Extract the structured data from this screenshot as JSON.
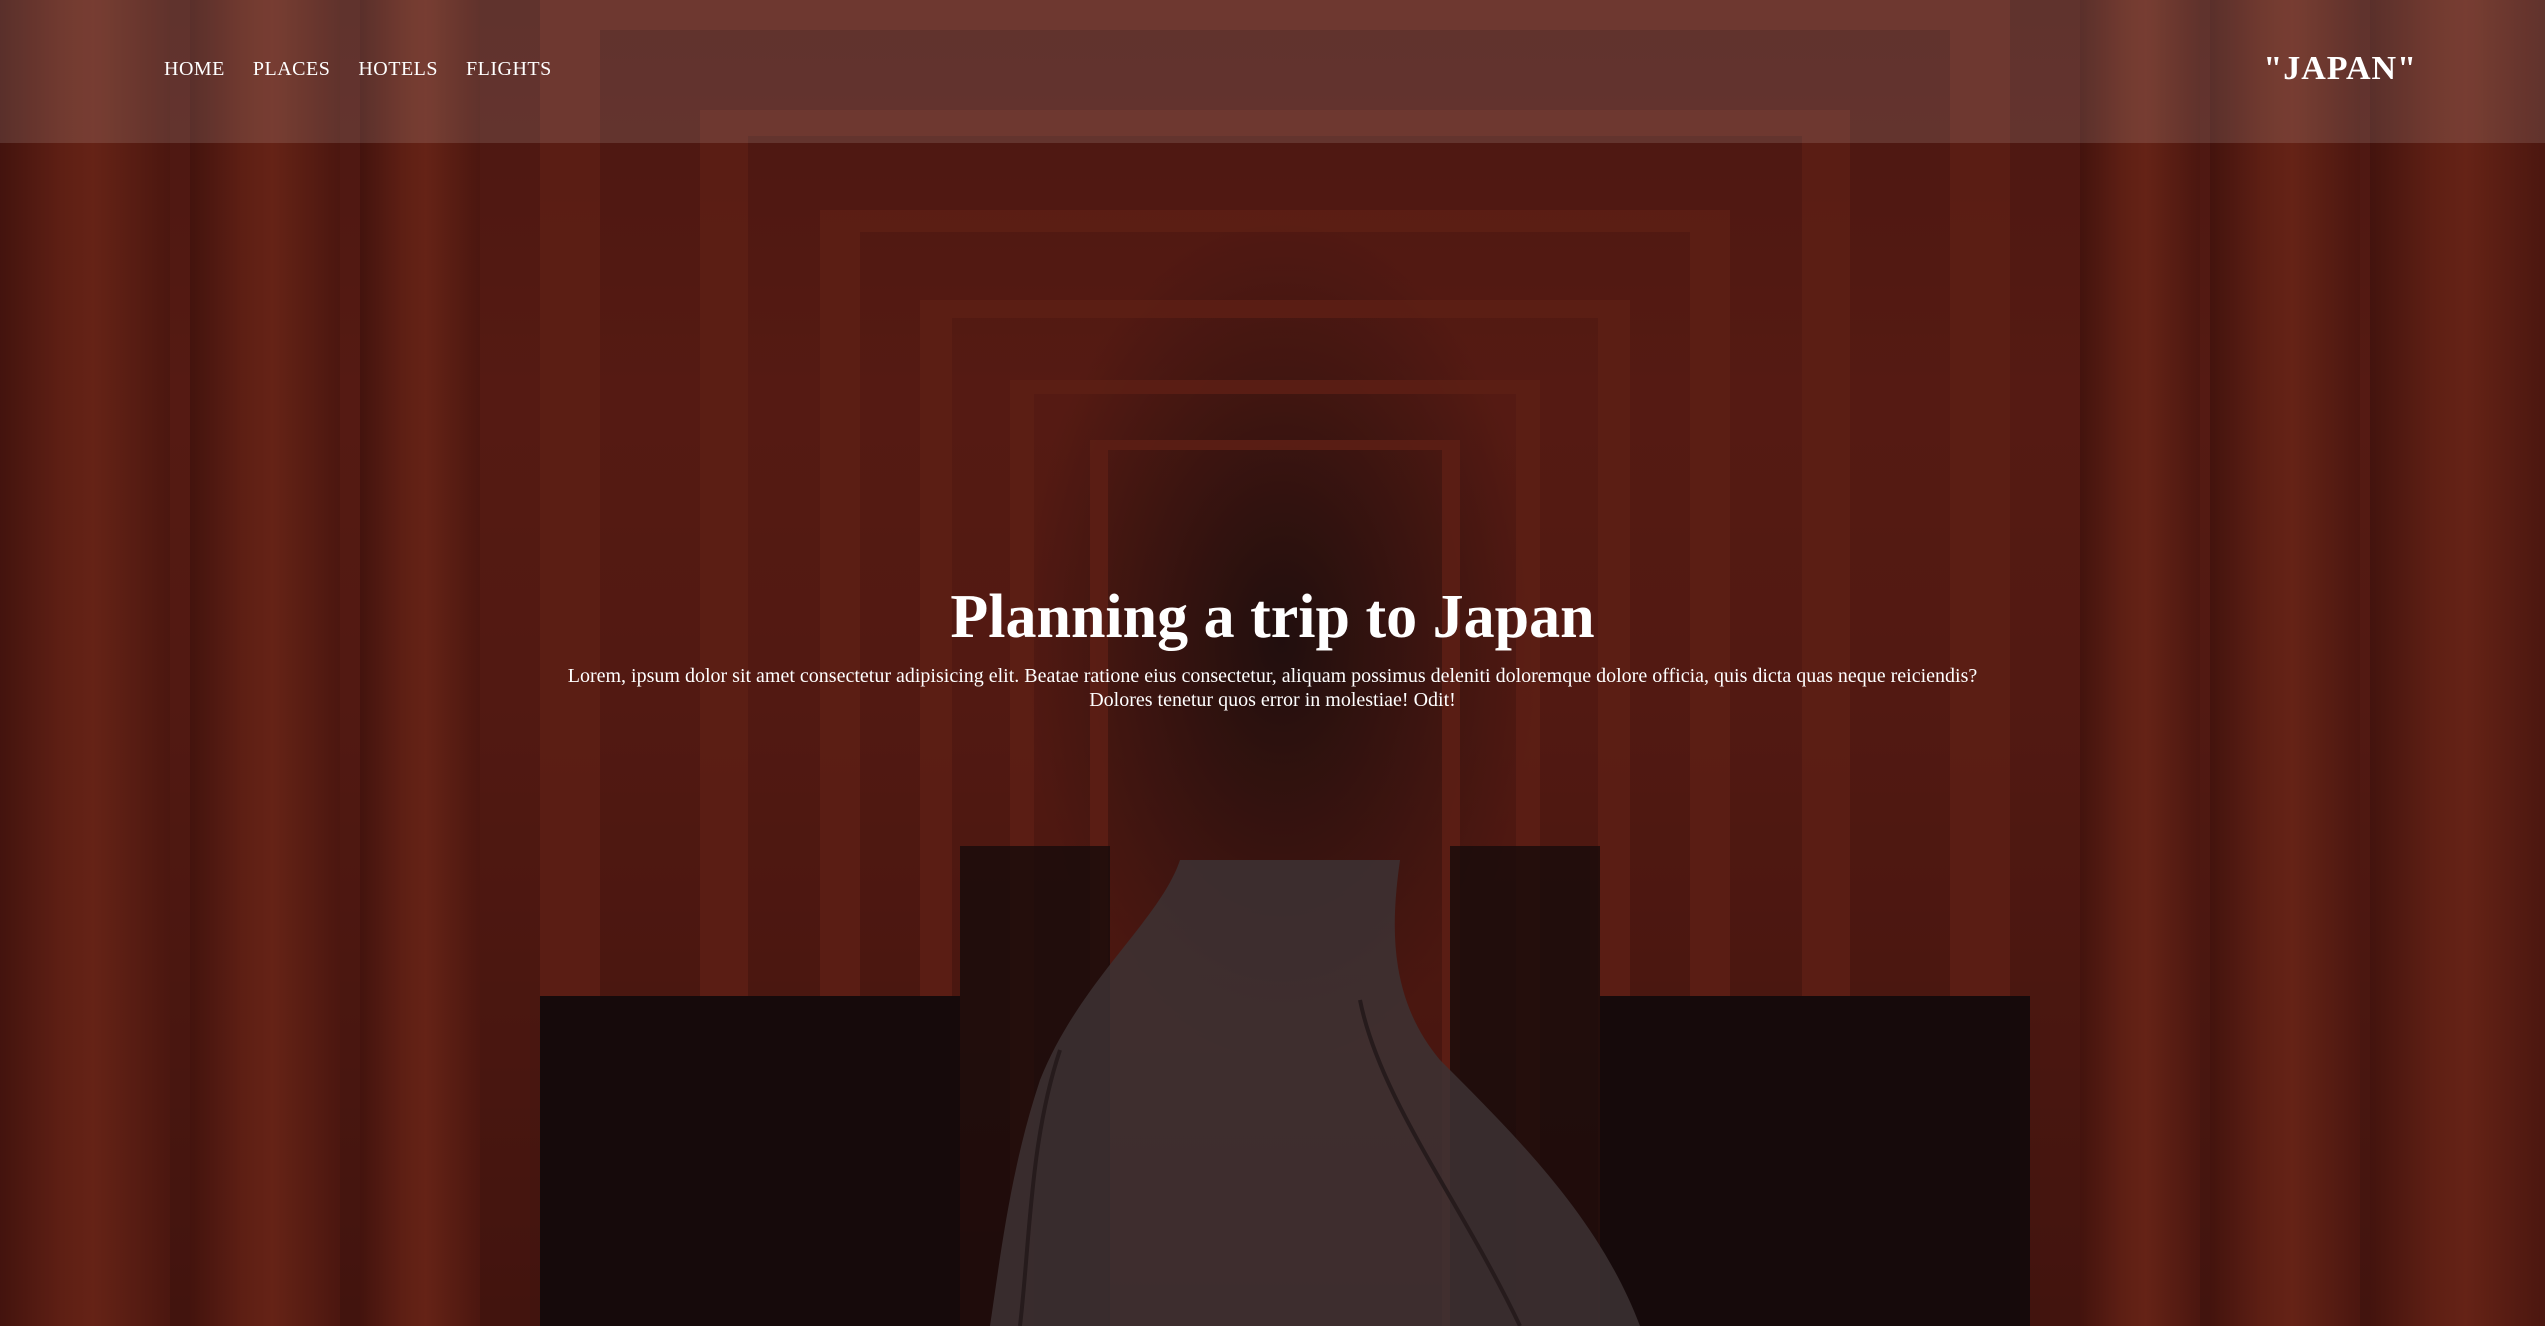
{
  "nav": {
    "links": [
      {
        "label": "HOME"
      },
      {
        "label": "PLACES"
      },
      {
        "label": "HOTELS"
      },
      {
        "label": "FLIGHTS"
      }
    ],
    "brand": "\"JAPAN\""
  },
  "hero": {
    "headline": "Planning a trip to Japan",
    "lead": "Lorem, ipsum dolor sit amet consectetur adipisicing elit. Beatae ratione eius consectetur, aliquam possimus deleniti doloremque dolore officia, quis dicta quas neque reiciendis? Dolores tenetur quos error in molestiae! Odit!",
    "background_image": "torii-gates-tunnel"
  },
  "colors": {
    "overlay": "#14080a",
    "text": "#ffffff",
    "torii_red": "#b33b23"
  }
}
